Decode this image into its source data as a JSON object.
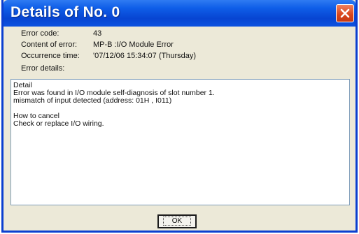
{
  "window": {
    "title": "Details of No. 0"
  },
  "info": [
    {
      "label": "Error code:",
      "value": "43"
    },
    {
      "label": "Content of error:",
      "value": "MP-B :I/O Module Error"
    },
    {
      "label": "Occurrence time:",
      "value": "'07/12/06 15:34:07 (Thursday)"
    },
    {
      "label": "Error details:",
      "value": ""
    }
  ],
  "details": {
    "lines": [
      "Detail",
      "Error was found in I/O module self-diagnosis of slot number 1.",
      "mismatch of input detected (address: 01H , I011)",
      "",
      "How to cancel",
      "Check or replace I/O wiring."
    ]
  },
  "buttons": {
    "ok_label": "OK"
  },
  "colors": {
    "title_bar": "#0745d2",
    "close_button": "#d8441b",
    "dialog_bg": "#ece9d8"
  }
}
